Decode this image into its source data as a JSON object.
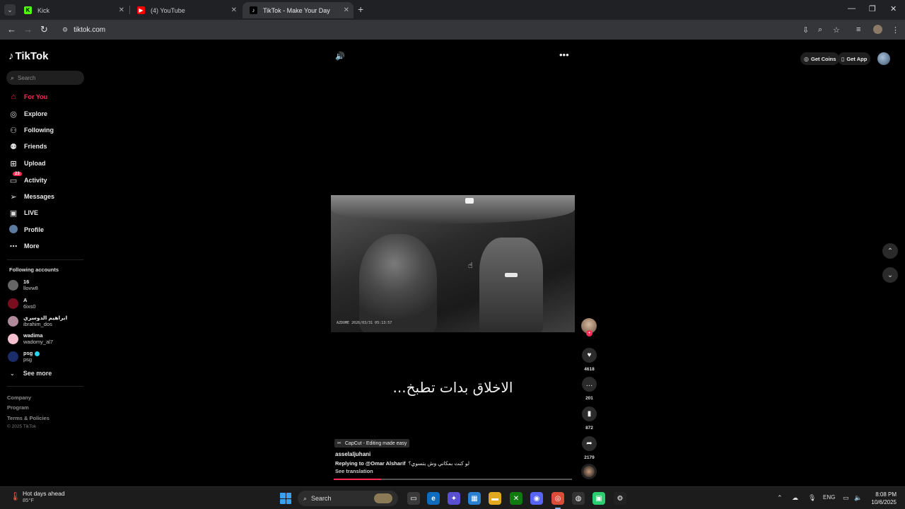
{
  "browser": {
    "tabs": [
      {
        "label": "Kick",
        "icon": "kick-favicon",
        "color": "#53fc18"
      },
      {
        "label": "(4) YouTube",
        "icon": "youtube-favicon",
        "color": "#ff0000"
      },
      {
        "label": "TikTok - Make Your Day",
        "icon": "tiktok-favicon",
        "color": "#ffffff"
      }
    ],
    "url": "tiktok.com"
  },
  "sidebar": {
    "logo": "TikTok",
    "search_placeholder": "Search",
    "nav": [
      {
        "label": "For You",
        "icon": "home-icon"
      },
      {
        "label": "Explore",
        "icon": "compass-icon"
      },
      {
        "label": "Following",
        "icon": "following-icon"
      },
      {
        "label": "Friends",
        "icon": "friends-icon"
      },
      {
        "label": "Upload",
        "icon": "upload-icon"
      },
      {
        "label": "Activity",
        "icon": "activity-icon",
        "badge": "23"
      },
      {
        "label": "Messages",
        "icon": "messages-icon"
      },
      {
        "label": "LIVE",
        "icon": "live-icon"
      },
      {
        "label": "Profile",
        "icon": "profile-icon"
      },
      {
        "label": "More",
        "icon": "more-icon"
      }
    ],
    "following_header": "Following accounts",
    "accounts": [
      {
        "name": "16",
        "handle": "llovw8",
        "color": "#666666"
      },
      {
        "name": "A",
        "handle": "6ixs0",
        "color": "#7a0e1e"
      },
      {
        "name": "ابراهيم الدوسري",
        "handle": "ibrahim_dos",
        "color": "#b08a9a"
      },
      {
        "name": "wadima",
        "handle": "wadomy_al7",
        "color": "#f4c0d0"
      },
      {
        "name": "psg",
        "handle": "psg",
        "color": "#1b2c6b",
        "verified": true
      }
    ],
    "see_more": "See more",
    "footer": [
      "Company",
      "Program",
      "Terms & Policies"
    ],
    "copyright": "© 2025 TikTok"
  },
  "video": {
    "dashcam_stamp": "AZDOME  2026/03/31  05:13:57",
    "caption_overlay": "الاخلاق بدات تطبخ...",
    "capcut_label": "CapCut - Editing made easy",
    "author": "asselaljuhani",
    "reply_prefix": "Replying to @Omar Alsharif",
    "reply_text": "لو كنت بمكاني وش بتسوي؟",
    "see_translation": "See translation",
    "progress": 0.2
  },
  "actions": {
    "likes": "4618",
    "comments": "201",
    "saves": "872",
    "shares": "2179"
  },
  "topbar": {
    "get_coins": "Get Coins",
    "get_app": "Get App"
  },
  "taskbar": {
    "weather_title": "Hot days ahead",
    "weather_temp": "85°F",
    "search": "Search",
    "language": "ENG",
    "time": "8:08 PM",
    "date": "10/6/2025"
  }
}
